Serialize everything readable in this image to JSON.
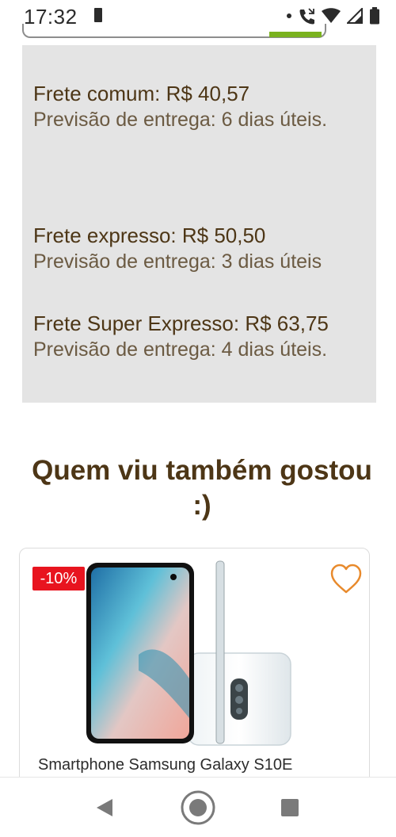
{
  "status_bar": {
    "time": "17:32",
    "icons": [
      "sd-card-icon",
      "notification-dot-icon",
      "call-icon",
      "wifi-icon",
      "cell-signal-icon",
      "battery-icon"
    ]
  },
  "colors": {
    "heading_brown": "#4d3616",
    "badge_red": "#e8141f",
    "heart_orange": "#e88a2c",
    "progress_green": "#7ab21f",
    "shipping_bg": "#e4e4e4"
  },
  "shipping": {
    "options": [
      {
        "title": "Frete comum: R$ 40,57",
        "eta": "Previsão de entrega: 6 dias úteis."
      },
      {
        "title": "Frete expresso: R$ 50,50",
        "eta": "Previsão de entrega: 3 dias úteis"
      },
      {
        "title": "Frete Super Expresso: R$ 63,75",
        "eta": "Previsão de entrega: 4 dias úteis."
      }
    ]
  },
  "recommendations": {
    "heading": "Quem viu também gostou :)",
    "products": [
      {
        "name": "Smartphone Samsung Galaxy S10E",
        "badge": "-10%",
        "icon": "heart-outline-icon"
      }
    ]
  },
  "navigation": {
    "buttons": [
      "back-icon",
      "home-icon",
      "recents-icon"
    ]
  }
}
